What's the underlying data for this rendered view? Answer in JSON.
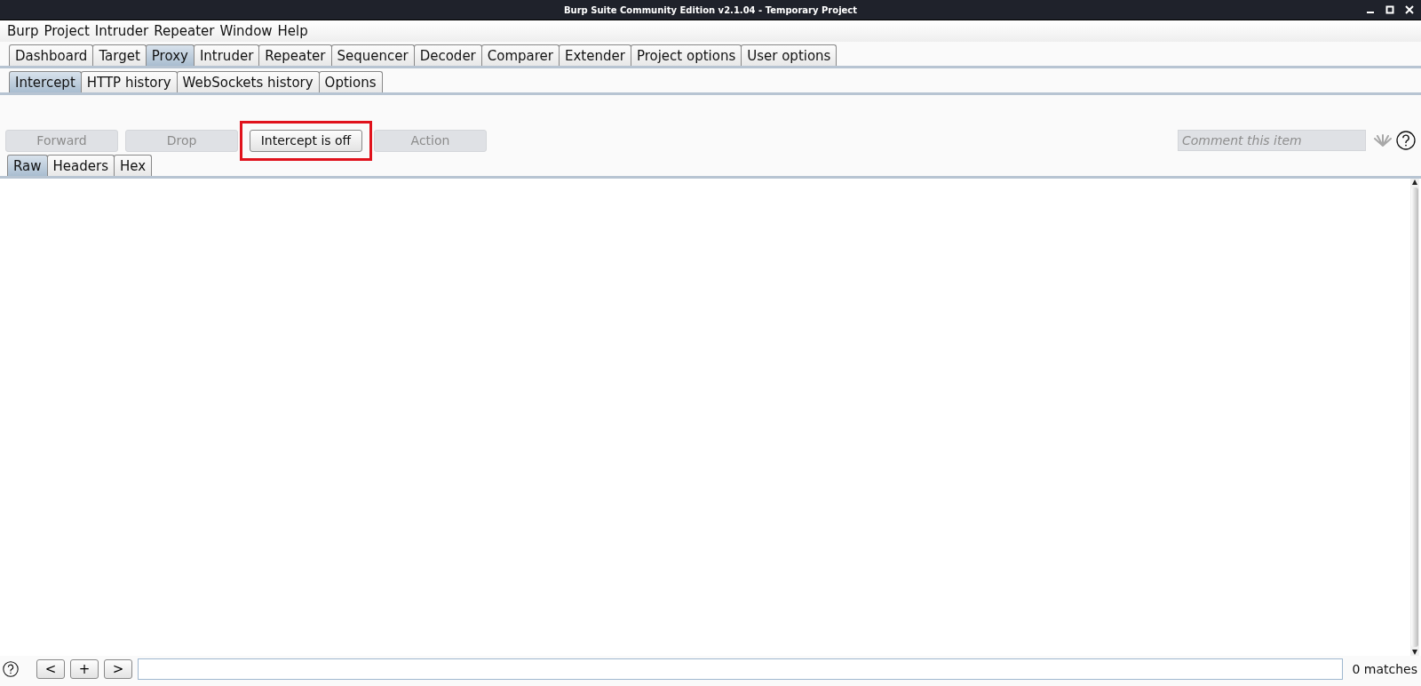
{
  "window": {
    "title": "Burp Suite Community Edition v2.1.04 - Temporary Project"
  },
  "menu": [
    "Burp",
    "Project",
    "Intruder",
    "Repeater",
    "Window",
    "Help"
  ],
  "tabs": [
    {
      "label": "Dashboard",
      "selected": false
    },
    {
      "label": "Target",
      "selected": false
    },
    {
      "label": "Proxy",
      "selected": true
    },
    {
      "label": "Intruder",
      "selected": false
    },
    {
      "label": "Repeater",
      "selected": false
    },
    {
      "label": "Sequencer",
      "selected": false
    },
    {
      "label": "Decoder",
      "selected": false
    },
    {
      "label": "Comparer",
      "selected": false
    },
    {
      "label": "Extender",
      "selected": false
    },
    {
      "label": "Project options",
      "selected": false
    },
    {
      "label": "User options",
      "selected": false
    }
  ],
  "subtabs": [
    {
      "label": "Intercept",
      "selected": true
    },
    {
      "label": "HTTP history",
      "selected": false
    },
    {
      "label": "WebSockets history",
      "selected": false
    },
    {
      "label": "Options",
      "selected": false
    }
  ],
  "toolbar": {
    "buttons": [
      {
        "label": "Forward",
        "disabled": true,
        "highlighted": false
      },
      {
        "label": "Drop",
        "disabled": true,
        "highlighted": false
      },
      {
        "label": "Intercept is off",
        "disabled": false,
        "highlighted": true
      },
      {
        "label": "Action",
        "disabled": true,
        "highlighted": false
      }
    ],
    "comment": {
      "placeholder": "Comment this item"
    }
  },
  "editor_tabs": [
    {
      "label": "Raw",
      "selected": true
    },
    {
      "label": "Headers",
      "selected": false
    },
    {
      "label": "Hex",
      "selected": false
    }
  ],
  "search_bar": {
    "buttons": [
      "<",
      "+",
      ">"
    ],
    "matches": "0 matches"
  }
}
